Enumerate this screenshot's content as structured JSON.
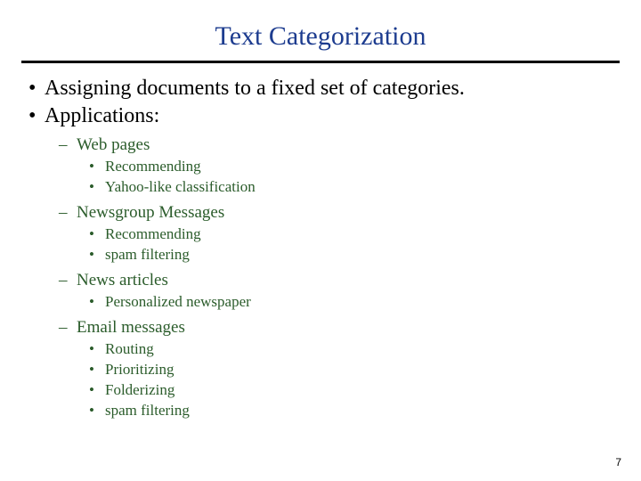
{
  "title": "Text Categorization",
  "bullets": [
    "Assigning documents to a fixed set of categories.",
    "Applications:"
  ],
  "applications": [
    {
      "name": "Web pages",
      "items": [
        "Recommending",
        "Yahoo-like classification"
      ]
    },
    {
      "name": "Newsgroup Messages",
      "items": [
        "Recommending",
        "spam filtering"
      ]
    },
    {
      "name": "News articles",
      "items": [
        "Personalized newspaper"
      ]
    },
    {
      "name": "Email messages",
      "items": [
        "Routing",
        "Prioritizing",
        "Folderizing",
        "spam filtering"
      ]
    }
  ],
  "page_number": "7"
}
